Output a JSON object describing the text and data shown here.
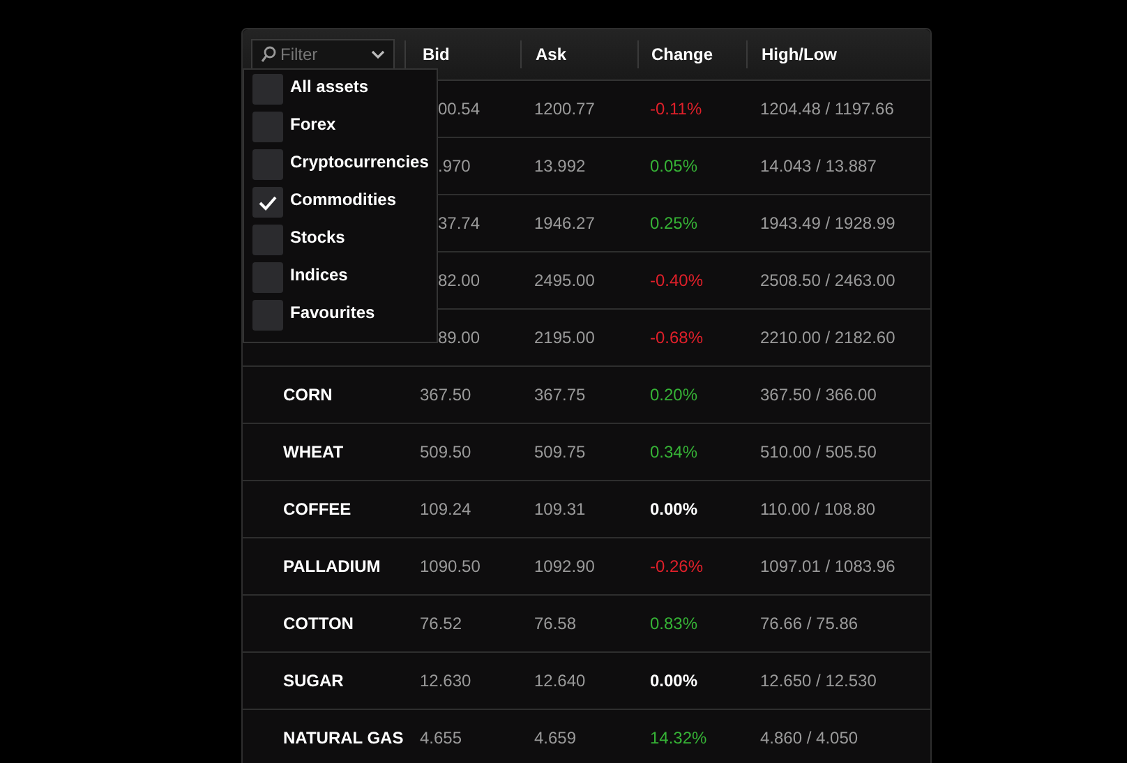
{
  "filter": {
    "placeholder": "Filter"
  },
  "columns": [
    "Bid",
    "Ask",
    "Change",
    "High/Low"
  ],
  "dropdown": [
    {
      "label": "All assets",
      "checked": false
    },
    {
      "label": "Forex",
      "checked": false
    },
    {
      "label": "Cryptocurrencies",
      "checked": false
    },
    {
      "label": "Commodities",
      "checked": true
    },
    {
      "label": "Stocks",
      "checked": false
    },
    {
      "label": "Indices",
      "checked": false
    },
    {
      "label": "Favourites",
      "checked": false
    }
  ],
  "rows": [
    {
      "bid": "00.54",
      "ask": "1200.77",
      "change": "-0.11%",
      "color": "#e0202a",
      "high_low": "1204.48 / 1197.66"
    },
    {
      "bid": ".970",
      "ask": "13.992",
      "change": "0.05%",
      "color": "#36b336",
      "high_low": "14.043 / 13.887"
    },
    {
      "bid": "37.74",
      "ask": "1946.27",
      "change": "0.25%",
      "color": "#36b336",
      "high_low": "1943.49 / 1928.99"
    },
    {
      "bid": "82.00",
      "ask": "2495.00",
      "change": "-0.40%",
      "color": "#e0202a",
      "high_low": "2508.50 / 2463.00"
    },
    {
      "bid": "89.00",
      "ask": "2195.00",
      "change": "-0.68%",
      "color": "#e0202a",
      "high_low": "2210.00 / 2182.60"
    },
    {
      "name": "CORN",
      "bid": "367.50",
      "ask": "367.75",
      "change": "0.20%",
      "color": "#36b336",
      "high_low": "367.50 / 366.00"
    },
    {
      "name": "WHEAT",
      "bid": "509.50",
      "ask": "509.75",
      "change": "0.34%",
      "color": "#36b336",
      "high_low": "510.00 / 505.50"
    },
    {
      "name": "COFFEE",
      "bid": "109.24",
      "ask": "109.31",
      "change": "0.00%",
      "color": "#ffffff",
      "high_low": "110.00 / 108.80"
    },
    {
      "name": "PALLADIUM",
      "bid": "1090.50",
      "ask": "1092.90",
      "change": "-0.26%",
      "color": "#e0202a",
      "high_low": "1097.01 / 1083.96"
    },
    {
      "name": "COTTON",
      "bid": "76.52",
      "ask": "76.58",
      "change": "0.83%",
      "color": "#36b336",
      "high_low": "76.66 / 75.86"
    },
    {
      "name": "SUGAR",
      "bid": "12.630",
      "ask": "12.640",
      "change": "0.00%",
      "color": "#ffffff",
      "high_low": "12.650 / 12.530"
    },
    {
      "name": "NATURAL GAS",
      "bid": "4.655",
      "ask": "4.659",
      "change": "14.32%",
      "color": "#36b336",
      "high_low": "4.860 / 4.050"
    }
  ]
}
